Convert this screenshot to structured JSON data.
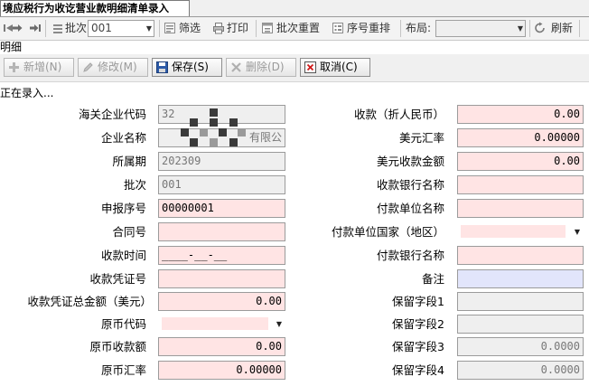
{
  "tab": {
    "title": "境应税行为收讫营业款明细清单录入"
  },
  "toolbar": {
    "batch_label": "批次:",
    "batch_value": "001",
    "filter_label": "筛选",
    "print_label": "打印",
    "batch_reset_label": "批次重置",
    "seq_reorder_label": "序号重排",
    "layout_label": "布局:",
    "layout_value": "",
    "refresh_label": "刷新"
  },
  "section": {
    "title": "明细",
    "status": "正在录入..."
  },
  "actions": {
    "add": "新增(N)",
    "edit": "修改(M)",
    "save": "保存(S)",
    "delete": "删除(D)",
    "cancel": "取消(C)"
  },
  "form_left": [
    {
      "label": "海关企业代码",
      "value": "32",
      "style": "gray"
    },
    {
      "label": "企业名称",
      "value": "有限公",
      "style": "gray"
    },
    {
      "label": "所属期",
      "value": "202309",
      "style": "gray"
    },
    {
      "label": "批次",
      "value": "001",
      "style": "gray"
    },
    {
      "label": "申报序号",
      "value": "00000001",
      "style": "pink"
    },
    {
      "label": "合同号",
      "value": "",
      "style": "pink"
    },
    {
      "label": "收款时间",
      "value": "____-__-__",
      "style": "pink"
    },
    {
      "label": "收款凭证号",
      "value": "",
      "style": "pink"
    },
    {
      "label": "收款凭证总金额（美元）",
      "value": "0.00",
      "style": "pink"
    },
    {
      "label": "原币代码",
      "value": "",
      "style": "dropdown"
    },
    {
      "label": "原币收款额",
      "value": "0.00",
      "style": "pink"
    },
    {
      "label": "原币汇率",
      "value": "0.00000",
      "style": "pink"
    }
  ],
  "form_right": [
    {
      "label": "收款（折人民币）",
      "value": "0.00",
      "style": "pink"
    },
    {
      "label": "美元汇率",
      "value": "0.00000",
      "style": "pink"
    },
    {
      "label": "美元收款金额",
      "value": "0.00",
      "style": "pink"
    },
    {
      "label": "收款银行名称",
      "value": "",
      "style": "pink"
    },
    {
      "label": "付款单位名称",
      "value": "",
      "style": "pink"
    },
    {
      "label": "付款单位国家（地区）",
      "value": "",
      "style": "dropdown"
    },
    {
      "label": "付款银行名称",
      "value": "",
      "style": "pink"
    },
    {
      "label": "备注",
      "value": "",
      "style": "lav"
    },
    {
      "label": "保留字段1",
      "value": "",
      "style": "gray"
    },
    {
      "label": "保留字段2",
      "value": "",
      "style": "gray"
    },
    {
      "label": "保留字段3",
      "value": "0.0000",
      "style": "gray"
    },
    {
      "label": "保留字段4",
      "value": "0.0000",
      "style": "gray"
    }
  ],
  "colors": {
    "required_field": "#ffe4e4",
    "readonly_field": "#efefef",
    "note_field": "#e2e5fb"
  }
}
